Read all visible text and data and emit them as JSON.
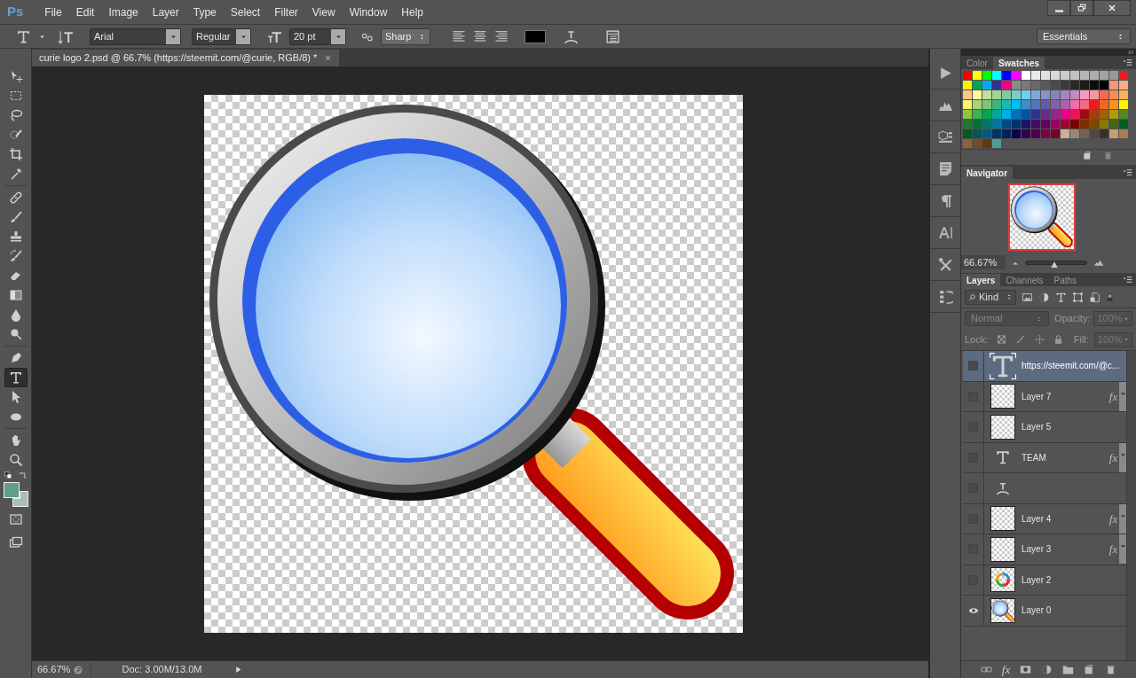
{
  "app_logo": "Ps",
  "menu": [
    "File",
    "Edit",
    "Image",
    "Layer",
    "Type",
    "Select",
    "Filter",
    "View",
    "Window",
    "Help"
  ],
  "options_bar": {
    "font_family": "Arial",
    "font_style": "Regular",
    "font_size": "20 pt",
    "anti_alias": "Sharp",
    "text_color": {
      "color": "#000000"
    },
    "workspace": "Essentials"
  },
  "document_tab": {
    "title": "curie logo 2.psd @ 66.7% (https://steemit.com/@curie, RGB/8) *"
  },
  "tools": [
    {
      "selected": false
    },
    {
      "selected": false
    },
    {
      "selected": false
    },
    {
      "selected": false
    },
    {
      "selected": false
    },
    {
      "selected": false
    },
    {
      "selected": false
    },
    {
      "selected": false
    },
    {
      "selected": false
    },
    {
      "selected": false
    },
    {
      "selected": false
    },
    {
      "selected": false
    },
    {
      "selected": false
    },
    {
      "selected": false
    },
    {
      "selected": false
    },
    {
      "selected": true
    },
    {
      "selected": false
    },
    {
      "selected": false
    },
    {
      "selected": false
    },
    {
      "selected": false
    }
  ],
  "color_chips": [
    {
      "kind": "foreground",
      "color": "#5e9e8c"
    },
    {
      "kind": "background",
      "color": "#a9c0b6"
    }
  ],
  "status_bar": {
    "zoom": "66.67%",
    "doc": "Doc: 3.00M/13.0M"
  },
  "swatches_panel": {
    "tabs": [
      {
        "label": "Color",
        "selected": false
      },
      {
        "label": "Swatches",
        "selected": true
      }
    ],
    "swatches": [
      {
        "color": "#ff0000"
      },
      {
        "color": "#ffff00"
      },
      {
        "color": "#00ff00"
      },
      {
        "color": "#00ffff"
      },
      {
        "color": "#0000ff"
      },
      {
        "color": "#ff00ff"
      },
      {
        "color": "#ffffff"
      },
      {
        "color": "#ebebeb"
      },
      {
        "color": "#e1e1e1"
      },
      {
        "color": "#d7d7d7"
      },
      {
        "color": "#cccccc"
      },
      {
        "color": "#c2c2c2"
      },
      {
        "color": "#b7b7b7"
      },
      {
        "color": "#adadad"
      },
      {
        "color": "#a2a2a2"
      },
      {
        "color": "#989898"
      },
      {
        "color": "#ed1c24"
      },
      {
        "color": "#fff200"
      },
      {
        "color": "#00a651"
      },
      {
        "color": "#00aeef"
      },
      {
        "color": "#2e3192"
      },
      {
        "color": "#ec008c"
      },
      {
        "color": "#8a8a8a"
      },
      {
        "color": "#7a7a7a"
      },
      {
        "color": "#6a6a6a"
      },
      {
        "color": "#5a5a5a"
      },
      {
        "color": "#4a4a4a"
      },
      {
        "color": "#3a3a3a"
      },
      {
        "color": "#2a2a2a"
      },
      {
        "color": "#1a1a1a"
      },
      {
        "color": "#0d0d0d"
      },
      {
        "color": "#000000"
      },
      {
        "color": "#f7977a"
      },
      {
        "color": "#f9ad81"
      },
      {
        "color": "#fdc68a"
      },
      {
        "color": "#fff79a"
      },
      {
        "color": "#c4df9b"
      },
      {
        "color": "#a3d39c"
      },
      {
        "color": "#82ca9d"
      },
      {
        "color": "#7bcdc8"
      },
      {
        "color": "#6ecff6"
      },
      {
        "color": "#7ea7d8"
      },
      {
        "color": "#8493ca"
      },
      {
        "color": "#8882be"
      },
      {
        "color": "#a187be"
      },
      {
        "color": "#bc8dbf"
      },
      {
        "color": "#f49ac2"
      },
      {
        "color": "#f6989d"
      },
      {
        "color": "#f26c4f"
      },
      {
        "color": "#f68e55"
      },
      {
        "color": "#fbaf5d"
      },
      {
        "color": "#fff467"
      },
      {
        "color": "#acd372"
      },
      {
        "color": "#7cc576"
      },
      {
        "color": "#3bb878"
      },
      {
        "color": "#1abbb4"
      },
      {
        "color": "#00bff3"
      },
      {
        "color": "#438ccb"
      },
      {
        "color": "#5574b9"
      },
      {
        "color": "#605ca8"
      },
      {
        "color": "#855fa8"
      },
      {
        "color": "#a763a8"
      },
      {
        "color": "#f06eaa"
      },
      {
        "color": "#f26d7d"
      },
      {
        "color": "#ed1c24"
      },
      {
        "color": "#f26522"
      },
      {
        "color": "#f7941d"
      },
      {
        "color": "#fff200"
      },
      {
        "color": "#8dc73f"
      },
      {
        "color": "#39b54a"
      },
      {
        "color": "#00a651"
      },
      {
        "color": "#00a99d"
      },
      {
        "color": "#00aeef"
      },
      {
        "color": "#0072bc"
      },
      {
        "color": "#0054a6"
      },
      {
        "color": "#2e3192"
      },
      {
        "color": "#662d91"
      },
      {
        "color": "#92278f"
      },
      {
        "color": "#ec008c"
      },
      {
        "color": "#ed145b"
      },
      {
        "color": "#9e0b0f"
      },
      {
        "color": "#a0410d"
      },
      {
        "color": "#a36209"
      },
      {
        "color": "#aba000"
      },
      {
        "color": "#598527"
      },
      {
        "color": "#197b30"
      },
      {
        "color": "#007236"
      },
      {
        "color": "#00746b"
      },
      {
        "color": "#0076a3"
      },
      {
        "color": "#004a80"
      },
      {
        "color": "#003471"
      },
      {
        "color": "#1b1464"
      },
      {
        "color": "#440e62"
      },
      {
        "color": "#630460"
      },
      {
        "color": "#9e005d"
      },
      {
        "color": "#9e0039"
      },
      {
        "color": "#790000"
      },
      {
        "color": "#7b2e00"
      },
      {
        "color": "#7d4900"
      },
      {
        "color": "#827b00"
      },
      {
        "color": "#406618"
      },
      {
        "color": "#005e20"
      },
      {
        "color": "#005826"
      },
      {
        "color": "#005952"
      },
      {
        "color": "#005b7f"
      },
      {
        "color": "#003663"
      },
      {
        "color": "#002157"
      },
      {
        "color": "#0d004c"
      },
      {
        "color": "#32004b"
      },
      {
        "color": "#4b0049"
      },
      {
        "color": "#7b0046"
      },
      {
        "color": "#7a0026"
      },
      {
        "color": "#c7b299"
      },
      {
        "color": "#998675"
      },
      {
        "color": "#736357"
      },
      {
        "color": "#534741"
      },
      {
        "color": "#37302d"
      },
      {
        "color": "#c69c6d"
      },
      {
        "color": "#a67c52"
      },
      {
        "color": "#8c6239"
      },
      {
        "color": "#754c24"
      },
      {
        "color": "#603913"
      },
      {
        "color": "#4d9e99"
      }
    ]
  },
  "navigator": {
    "title": "Navigator",
    "zoom": "66.67%",
    "zoom_slider": {
      "level": 0.47
    }
  },
  "layers_panel": {
    "tabs": [
      {
        "label": "Layers",
        "selected": true
      },
      {
        "label": "Channels",
        "selected": false
      },
      {
        "label": "Paths",
        "selected": false
      }
    ],
    "filter": "Kind",
    "blend_mode": "Normal",
    "opacity_label": "Opacity:",
    "opacity": "100%",
    "lock_label": "Lock:",
    "fill_label": "Fill:",
    "fill": "100%",
    "footer_fx": "fx",
    "layers": [
      {
        "name": "https://steemit.com/@c...",
        "kind": "text",
        "visible": false,
        "selected": true
      },
      {
        "name": "Layer 7",
        "kind": "pixel",
        "thumbnail": {
          "kind": "checker"
        },
        "visible": false,
        "selected": false,
        "effects": "fx"
      },
      {
        "name": "Layer 5",
        "kind": "pixel",
        "thumbnail": {
          "kind": "checker"
        },
        "visible": false,
        "selected": false
      },
      {
        "name": "TEAM",
        "kind": "text",
        "visible": false,
        "selected": false,
        "effects": "fx"
      },
      {
        "kind": "warp",
        "visible": false,
        "selected": false
      },
      {
        "name": "Layer 4",
        "kind": "pixel",
        "thumbnail": {
          "kind": "checker"
        },
        "visible": false,
        "selected": false,
        "effects": "fx"
      },
      {
        "name": "Layer 3",
        "kind": "pixel",
        "thumbnail": {
          "kind": "checker"
        },
        "visible": false,
        "selected": false,
        "effects": "fx"
      },
      {
        "name": "Layer 2",
        "kind": "pixel",
        "thumbnail": {
          "kind": "ring"
        },
        "visible": false,
        "selected": false
      },
      {
        "name": "Layer 0",
        "kind": "pixel",
        "thumbnail": {
          "kind": "magnifier"
        },
        "visible": true,
        "selected": false
      }
    ]
  }
}
